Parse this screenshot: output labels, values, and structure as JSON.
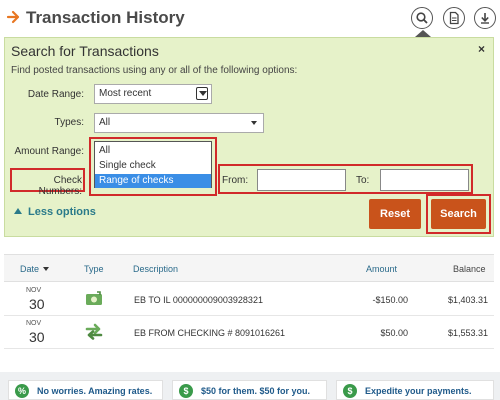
{
  "header": {
    "title": "Transaction History",
    "icons": [
      "search-icon",
      "document-icon",
      "download-icon"
    ],
    "accent_color": "#e87722"
  },
  "search_panel": {
    "title": "Search for Transactions",
    "subtitle": "Find posted transactions using any or all of the following options:",
    "close_label": "×",
    "date_range": {
      "label": "Date Range:",
      "value": "Most recent"
    },
    "types": {
      "label": "Types:",
      "value": "All"
    },
    "amount_range": {
      "label": "Amount Range:"
    },
    "check_numbers": {
      "label": "Check Numbers:",
      "options": [
        "All",
        "Single check",
        "Range of checks"
      ],
      "selected": "Range of checks"
    },
    "from": {
      "label": "From:",
      "value": ""
    },
    "to": {
      "label": "To:",
      "value": ""
    },
    "less_options": "Less options",
    "reset_label": "Reset",
    "search_label": "Search",
    "panel_color": "#e6f2c9",
    "button_color": "#c9531b",
    "highlight_color": "#d12a2a"
  },
  "table": {
    "headers": {
      "date": "Date",
      "type": "Type",
      "description": "Description",
      "amount": "Amount",
      "balance": "Balance"
    },
    "rows": [
      {
        "month": "NOV",
        "day": "30",
        "type_icon": "deposit-icon",
        "description": "EB TO IL 000000009003928321",
        "amount": "-$150.00",
        "balance": "$1,403.31"
      },
      {
        "month": "NOV",
        "day": "30",
        "type_icon": "transfer-icon",
        "description": "EB FROM CHECKING # 8091016261",
        "amount": "$50.00",
        "balance": "$1,553.31"
      }
    ]
  },
  "promos": [
    {
      "icon": "percent-icon",
      "glyph": "%",
      "text": "No worries. Amazing rates."
    },
    {
      "icon": "dollar-icon",
      "glyph": "$",
      "text": "$50 for them. $50 for you."
    },
    {
      "icon": "expedite-icon",
      "glyph": "$",
      "text": "Expedite your payments."
    }
  ]
}
